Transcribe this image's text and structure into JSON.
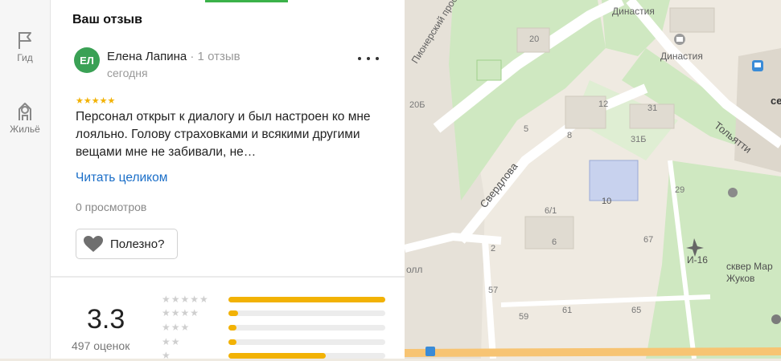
{
  "rail": {
    "items": [
      {
        "label": "Гид",
        "icon": "flag-icon"
      },
      {
        "label": "Жильё",
        "icon": "house-icon"
      }
    ]
  },
  "review": {
    "section_title": "Ваш отзыв",
    "author": {
      "initials": "ЕЛ",
      "name": "Елена Лапина",
      "meta": "· 1 отзыв",
      "date": "сегодня"
    },
    "rating_stars": "★★★★★",
    "text": "Персонал открыт к диалогу и был настроен ко мне лояльно. Голову страховками и всякими другими вещами мне не забивали, не…",
    "read_more": "Читать целиком",
    "views": "0 просмотров",
    "useful_label": "Полезно?"
  },
  "summary": {
    "score": "3.3",
    "count": "497 оценок",
    "distribution": [
      {
        "stars": 5,
        "fraction": 1.0
      },
      {
        "stars": 4,
        "fraction": 0.06
      },
      {
        "stars": 3,
        "fraction": 0.05
      },
      {
        "stars": 2,
        "fraction": 0.05
      },
      {
        "stars": 1,
        "fraction": 0.62
      }
    ]
  },
  "map": {
    "labels": {
      "dinastiya_1": "Династия",
      "dinastiya_2": "Династия",
      "pionerskiy": "Пионерский прос",
      "tolyatti": "Тольятти",
      "sverdlova": "Свердлова",
      "square": "сквер Мар",
      "square2": "Жуков",
      "i16": "И-16",
      "se": "се",
      "oll": "олл",
      "h20": "20",
      "h20b": "20Б",
      "h5": "5",
      "h8": "8",
      "h12": "12",
      "h31": "31",
      "h31b": "31Б",
      "h10": "10",
      "h29": "29",
      "h61": "6/1",
      "h6": "6",
      "h2": "2",
      "h67": "67",
      "h57": "57",
      "h59": "59",
      "h61b": "61",
      "h65": "65"
    }
  },
  "colors": {
    "accent_green": "#3bb24a",
    "link_blue": "#1a6ec8",
    "star_yellow": "#f2b205"
  }
}
